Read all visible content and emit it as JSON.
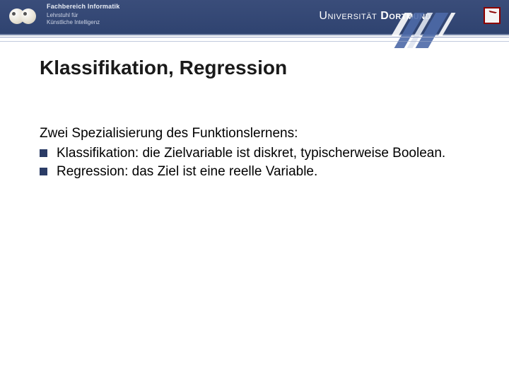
{
  "header": {
    "dept_line1": "Fachbereich Informatik",
    "dept_line2": "Lehrstuhl für",
    "dept_line3": "Künstliche Intelligenz",
    "university_prefix": "Universität",
    "university_name": "Dortmund"
  },
  "slide": {
    "title": "Klassifikation, Regression",
    "intro": "Zwei Spezialisierung des Funktionslernens:",
    "bullets": [
      "Klassifikation: die Zielvariable ist diskret, typischerweise Boolean.",
      "Regression: das Ziel ist eine reelle Variable."
    ]
  }
}
